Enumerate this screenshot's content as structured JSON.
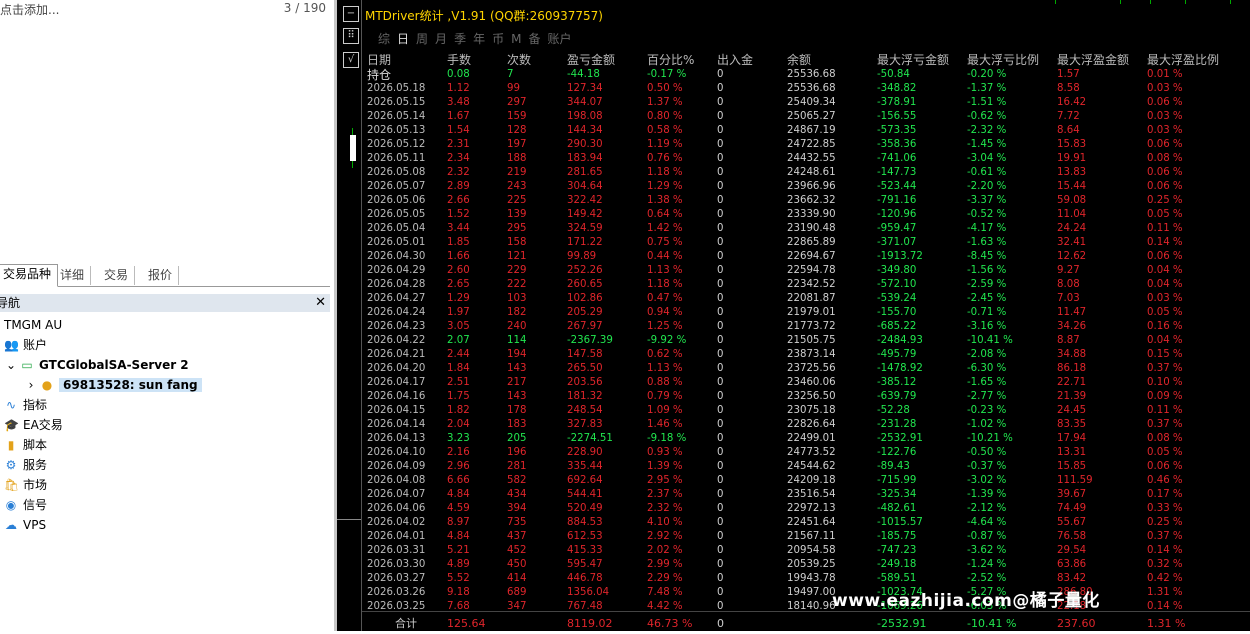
{
  "search": {
    "placeholder": "点击添加...",
    "counter": "3 / 190"
  },
  "tabs": [
    "交易品种",
    "详细",
    "交易",
    "报价"
  ],
  "navigator": {
    "title": "导航",
    "broker": "TMGM AU",
    "accounts_label": "账户",
    "server": "GTCGlobalSA-Server 2",
    "account": "69813528: sun fang",
    "items": [
      "指标",
      "EA交易",
      "脚本",
      "服务",
      "市场",
      "信号",
      "VPS"
    ]
  },
  "panel": {
    "title": "MTDriver统计 ,V1.91 (QQ群:260937757)",
    "menu": [
      "综",
      "日",
      "周",
      "月",
      "季",
      "年",
      "币",
      "M",
      "备",
      "账户"
    ],
    "active_menu": "日",
    "headers": [
      "日期",
      "手数",
      "次数",
      "盈亏金额",
      "百分比%",
      "出入金",
      "余额",
      "最大浮亏金额",
      "最大浮亏比例",
      "最大浮盈金额",
      "最大浮盈比例"
    ],
    "rows": [
      [
        "持仓",
        "0.08",
        "7",
        "-44.18",
        "-0.17 %",
        "0",
        "25536.68",
        "-50.84",
        "-0.20 %",
        "1.57",
        "0.01 %"
      ],
      [
        "2026.05.18",
        "1.12",
        "99",
        "127.34",
        "0.50 %",
        "0",
        "25536.68",
        "-348.82",
        "-1.37 %",
        "8.58",
        "0.03 %"
      ],
      [
        "2026.05.15",
        "3.48",
        "297",
        "344.07",
        "1.37 %",
        "0",
        "25409.34",
        "-378.91",
        "-1.51 %",
        "16.42",
        "0.06 %"
      ],
      [
        "2026.05.14",
        "1.67",
        "159",
        "198.08",
        "0.80 %",
        "0",
        "25065.27",
        "-156.55",
        "-0.62 %",
        "7.72",
        "0.03 %"
      ],
      [
        "2026.05.13",
        "1.54",
        "128",
        "144.34",
        "0.58 %",
        "0",
        "24867.19",
        "-573.35",
        "-2.32 %",
        "8.64",
        "0.03 %"
      ],
      [
        "2026.05.12",
        "2.31",
        "197",
        "290.30",
        "1.19 %",
        "0",
        "24722.85",
        "-358.36",
        "-1.45 %",
        "15.83",
        "0.06 %"
      ],
      [
        "2026.05.11",
        "2.34",
        "188",
        "183.94",
        "0.76 %",
        "0",
        "24432.55",
        "-741.06",
        "-3.04 %",
        "19.91",
        "0.08 %"
      ],
      [
        "2026.05.08",
        "2.32",
        "219",
        "281.65",
        "1.18 %",
        "0",
        "24248.61",
        "-147.73",
        "-0.61 %",
        "13.83",
        "0.06 %"
      ],
      [
        "2026.05.07",
        "2.89",
        "243",
        "304.64",
        "1.29 %",
        "0",
        "23966.96",
        "-523.44",
        "-2.20 %",
        "15.44",
        "0.06 %"
      ],
      [
        "2026.05.06",
        "2.66",
        "225",
        "322.42",
        "1.38 %",
        "0",
        "23662.32",
        "-791.16",
        "-3.37 %",
        "59.08",
        "0.25 %"
      ],
      [
        "2026.05.05",
        "1.52",
        "139",
        "149.42",
        "0.64 %",
        "0",
        "23339.90",
        "-120.96",
        "-0.52 %",
        "11.04",
        "0.05 %"
      ],
      [
        "2026.05.04",
        "3.44",
        "295",
        "324.59",
        "1.42 %",
        "0",
        "23190.48",
        "-959.47",
        "-4.17 %",
        "24.24",
        "0.11 %"
      ],
      [
        "2026.05.01",
        "1.85",
        "158",
        "171.22",
        "0.75 %",
        "0",
        "22865.89",
        "-371.07",
        "-1.63 %",
        "32.41",
        "0.14 %"
      ],
      [
        "2026.04.30",
        "1.66",
        "121",
        "99.89",
        "0.44 %",
        "0",
        "22694.67",
        "-1913.72",
        "-8.45 %",
        "12.62",
        "0.06 %"
      ],
      [
        "2026.04.29",
        "2.60",
        "229",
        "252.26",
        "1.13 %",
        "0",
        "22594.78",
        "-349.80",
        "-1.56 %",
        "9.27",
        "0.04 %"
      ],
      [
        "2026.04.28",
        "2.65",
        "222",
        "260.65",
        "1.18 %",
        "0",
        "22342.52",
        "-572.10",
        "-2.59 %",
        "8.08",
        "0.04 %"
      ],
      [
        "2026.04.27",
        "1.29",
        "103",
        "102.86",
        "0.47 %",
        "0",
        "22081.87",
        "-539.24",
        "-2.45 %",
        "7.03",
        "0.03 %"
      ],
      [
        "2026.04.24",
        "1.97",
        "182",
        "205.29",
        "0.94 %",
        "0",
        "21979.01",
        "-155.70",
        "-0.71 %",
        "11.47",
        "0.05 %"
      ],
      [
        "2026.04.23",
        "3.05",
        "240",
        "267.97",
        "1.25 %",
        "0",
        "21773.72",
        "-685.22",
        "-3.16 %",
        "34.26",
        "0.16 %"
      ],
      [
        "2026.04.22",
        "2.07",
        "114",
        "-2367.39",
        "-9.92 %",
        "0",
        "21505.75",
        "-2484.93",
        "-10.41 %",
        "8.87",
        "0.04 %"
      ],
      [
        "2026.04.21",
        "2.44",
        "194",
        "147.58",
        "0.62 %",
        "0",
        "23873.14",
        "-495.79",
        "-2.08 %",
        "34.88",
        "0.15 %"
      ],
      [
        "2026.04.20",
        "1.84",
        "143",
        "265.50",
        "1.13 %",
        "0",
        "23725.56",
        "-1478.92",
        "-6.30 %",
        "86.18",
        "0.37 %"
      ],
      [
        "2026.04.17",
        "2.51",
        "217",
        "203.56",
        "0.88 %",
        "0",
        "23460.06",
        "-385.12",
        "-1.65 %",
        "22.71",
        "0.10 %"
      ],
      [
        "2026.04.16",
        "1.75",
        "143",
        "181.32",
        "0.79 %",
        "0",
        "23256.50",
        "-639.79",
        "-2.77 %",
        "21.39",
        "0.09 %"
      ],
      [
        "2026.04.15",
        "1.82",
        "178",
        "248.54",
        "1.09 %",
        "0",
        "23075.18",
        "-52.28",
        "-0.23 %",
        "24.45",
        "0.11 %"
      ],
      [
        "2026.04.14",
        "2.04",
        "183",
        "327.83",
        "1.46 %",
        "0",
        "22826.64",
        "-231.28",
        "-1.02 %",
        "83.35",
        "0.37 %"
      ],
      [
        "2026.04.13",
        "3.23",
        "205",
        "-2274.51",
        "-9.18 %",
        "0",
        "22499.01",
        "-2532.91",
        "-10.21 %",
        "17.94",
        "0.08 %"
      ],
      [
        "2026.04.10",
        "2.16",
        "196",
        "228.90",
        "0.93 %",
        "0",
        "24773.52",
        "-122.76",
        "-0.50 %",
        "13.31",
        "0.05 %"
      ],
      [
        "2026.04.09",
        "2.96",
        "281",
        "335.44",
        "1.39 %",
        "0",
        "24544.62",
        "-89.43",
        "-0.37 %",
        "15.85",
        "0.06 %"
      ],
      [
        "2026.04.08",
        "6.66",
        "582",
        "692.64",
        "2.95 %",
        "0",
        "24209.18",
        "-715.99",
        "-3.02 %",
        "111.59",
        "0.46 %"
      ],
      [
        "2026.04.07",
        "4.84",
        "434",
        "544.41",
        "2.37 %",
        "0",
        "23516.54",
        "-325.34",
        "-1.39 %",
        "39.67",
        "0.17 %"
      ],
      [
        "2026.04.06",
        "4.59",
        "394",
        "520.49",
        "2.32 %",
        "0",
        "22972.13",
        "-482.61",
        "-2.12 %",
        "74.49",
        "0.33 %"
      ],
      [
        "2026.04.02",
        "8.97",
        "735",
        "884.53",
        "4.10 %",
        "0",
        "22451.64",
        "-1015.57",
        "-4.64 %",
        "55.67",
        "0.25 %"
      ],
      [
        "2026.04.01",
        "4.84",
        "437",
        "612.53",
        "2.92 %",
        "0",
        "21567.11",
        "-185.75",
        "-0.87 %",
        "76.58",
        "0.37 %"
      ],
      [
        "2026.03.31",
        "5.21",
        "452",
        "415.33",
        "2.02 %",
        "0",
        "20954.58",
        "-747.23",
        "-3.62 %",
        "29.54",
        "0.14 %"
      ],
      [
        "2026.03.30",
        "4.89",
        "450",
        "595.47",
        "2.99 %",
        "0",
        "20539.25",
        "-249.18",
        "-1.24 %",
        "63.86",
        "0.32 %"
      ],
      [
        "2026.03.27",
        "5.52",
        "414",
        "446.78",
        "2.29 %",
        "0",
        "19943.78",
        "-589.51",
        "-2.52 %",
        "83.42",
        "0.42 %"
      ],
      [
        "2026.03.26",
        "9.18",
        "689",
        "1356.04",
        "7.48 %",
        "0",
        "19497.00",
        "-1023.74",
        "-5.27 %",
        "286.80",
        "1.31 %"
      ],
      [
        "2026.03.25",
        "7.68",
        "347",
        "767.48",
        "4.42 %",
        "0",
        "18140.96",
        "-1069.26",
        "-6.03 %",
        "22.18",
        "0.14 %"
      ]
    ],
    "footer": {
      "label": "合计",
      "lots": "125.64",
      "pnl": "8119.02",
      "pct": "46.73 %",
      "dep": "0",
      "maxdd": "-2532.91",
      "maxddpct": "-10.41 %",
      "maxfp": "237.60",
      "maxfppct": "1.31 %"
    }
  },
  "watermark": "www.eazhijia.com@橘子量化",
  "colors": {
    "green": "#21e64f",
    "red": "#e0252b",
    "header": "#bcbcbc",
    "title": "#ffd400"
  }
}
